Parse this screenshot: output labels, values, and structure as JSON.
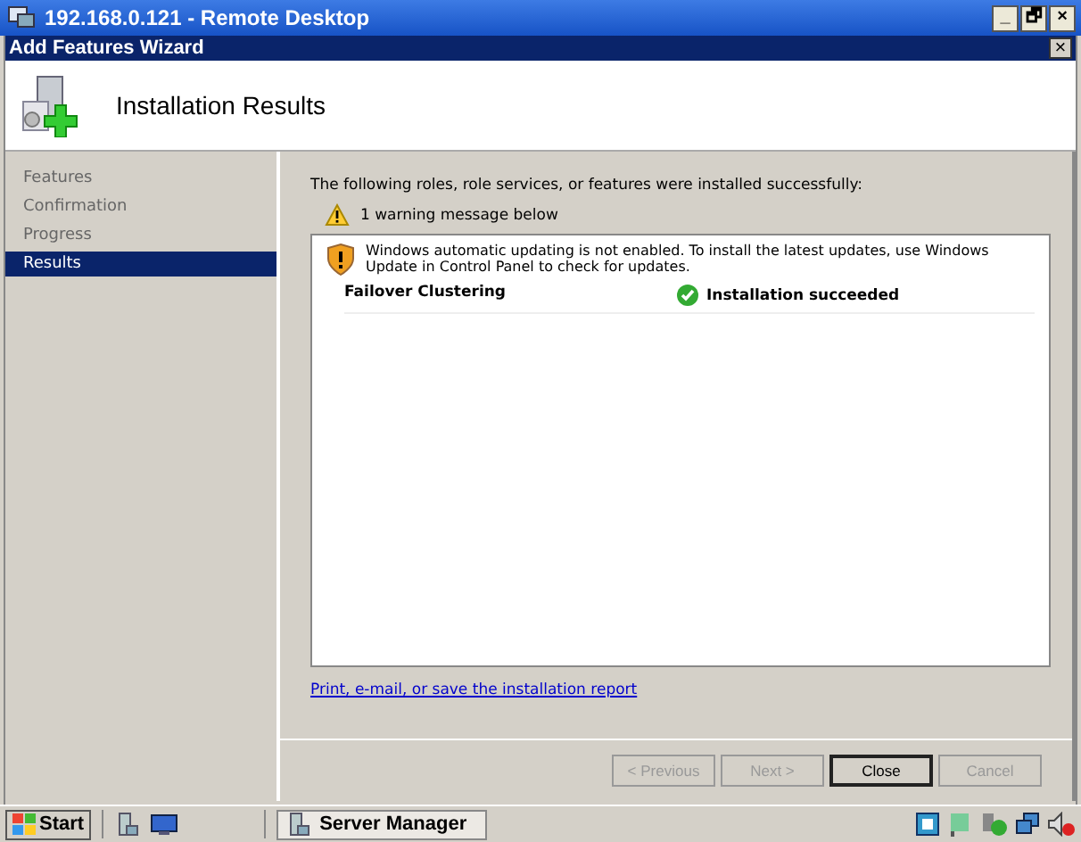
{
  "window": {
    "title": "192.168.0.121 - Remote Desktop",
    "controls": [
      "_",
      "🗗",
      "×"
    ]
  },
  "dialog": {
    "title": "Add Features Wizard",
    "close": "×",
    "heading": "Installation Results"
  },
  "nav": [
    {
      "label": "Features",
      "selected": false
    },
    {
      "label": "Confirmation",
      "selected": false
    },
    {
      "label": "Progress",
      "selected": false
    },
    {
      "label": "Results",
      "selected": true
    }
  ],
  "intro": "The following roles, role services, or features were installed successfully:",
  "warning_summary": "1 warning message below",
  "warning": "Windows automatic updating is not enabled. To install the latest updates, use Windows Update in Control Panel to check for updates.",
  "results": [
    {
      "feature": "Failover Clustering",
      "status": "Installation succeeded"
    }
  ],
  "report_link": "Print, e-mail, or save the installation report",
  "buttons": [
    {
      "label": "< Previous",
      "disabled": true
    },
    {
      "label": "Next >",
      "disabled": true
    },
    {
      "label": "Close",
      "disabled": false
    },
    {
      "label": "Cancel",
      "disabled": true
    }
  ],
  "taskbar": {
    "start": "Start",
    "task": "Server Manager"
  }
}
